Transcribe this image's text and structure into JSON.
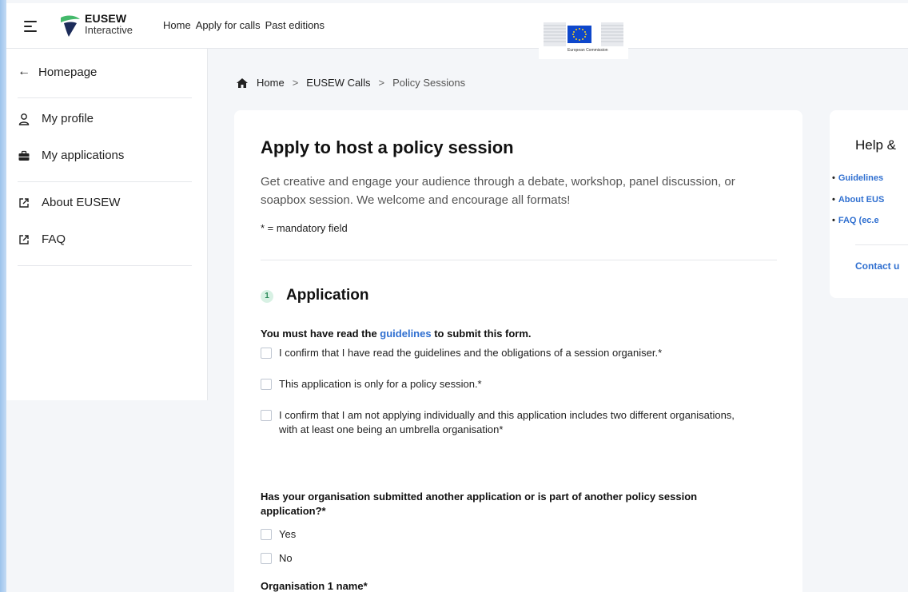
{
  "header": {
    "logo_title": "EUSEW",
    "logo_subtitle": "Interactive",
    "nav": [
      "Home",
      "Apply for calls",
      "Past editions"
    ],
    "ec_logo_text": "European Commission"
  },
  "sidebar": {
    "back": "Homepage",
    "items": [
      {
        "label": "My profile",
        "icon": "user-icon"
      },
      {
        "label": "My applications",
        "icon": "briefcase-icon"
      },
      {
        "label": "About EUSEW",
        "icon": "external-link-icon"
      },
      {
        "label": "FAQ",
        "icon": "external-link-icon"
      }
    ]
  },
  "breadcrumb": {
    "items": [
      "Home",
      "EUSEW Calls",
      "Policy Sessions"
    ],
    "separator": ">"
  },
  "form": {
    "title": "Apply to host a policy session",
    "intro": "Get creative and engage your audience through a debate, workshop, panel discussion, or soapbox session. We welcome and encourage all formats!",
    "mandatory_note": "* = mandatory field",
    "section_number": "1",
    "section_title": "Application",
    "must_read_prefix": "You must have read the ",
    "must_read_link": "guidelines",
    "must_read_suffix": " to submit this form.",
    "confirmations": [
      "I confirm that I have read the guidelines and the obligations of a session organiser.*",
      "This application is only for a policy session.*",
      "I confirm that I am not applying individually and this application includes two different organisations, with at least one being an umbrella organisation*"
    ],
    "question": "Has your organisation submitted another application or is part of another policy session application?*",
    "answers": [
      "Yes",
      "No"
    ],
    "org1_label": "Organisation 1 name*"
  },
  "help": {
    "title": "Help &",
    "links": [
      "Guidelines",
      "About EUS",
      "FAQ (ec.e"
    ],
    "contact": "Contact u"
  },
  "colors": {
    "accent": "#2f6fd0",
    "section_badge_bg": "#d8f1e4",
    "section_badge_fg": "#2c8a5a"
  }
}
